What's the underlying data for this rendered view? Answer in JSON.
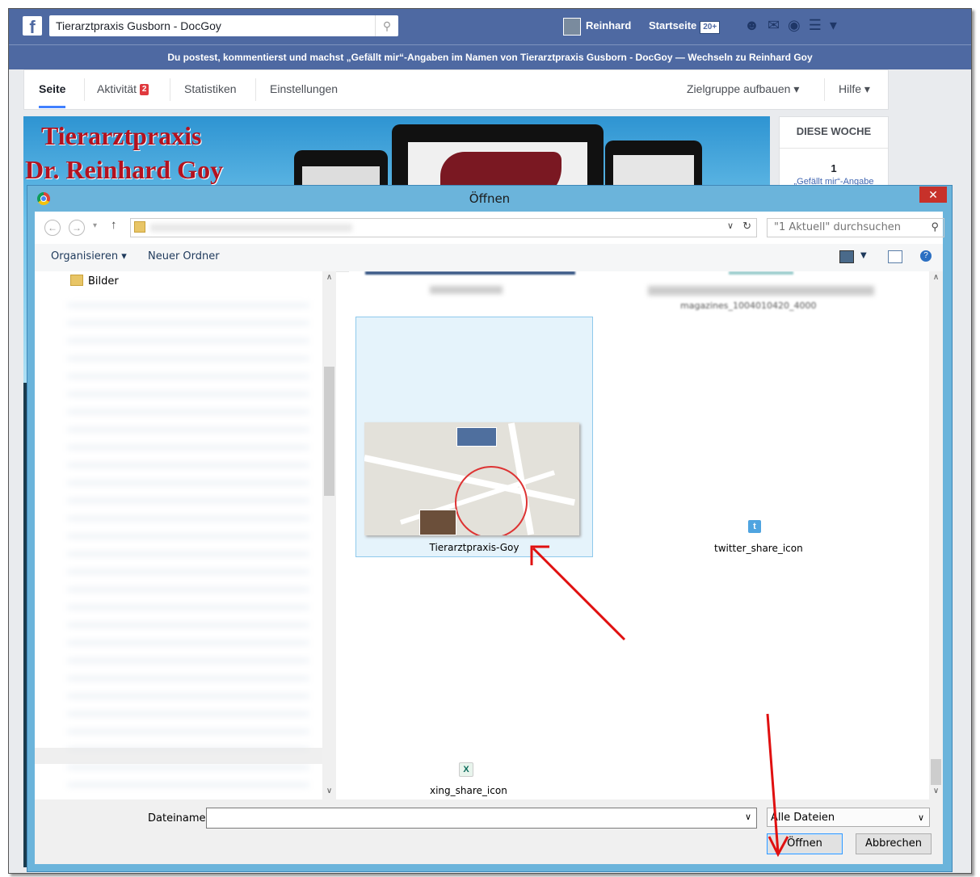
{
  "facebook": {
    "search_value": "Tierarztpraxis Gusborn - DocGoy",
    "user_name": "Reinhard",
    "home_label": "Startseite",
    "home_badge": "20+",
    "notice": "Du postest, kommentierst und machst „Gefällt mir“-Angaben im Namen von Tierarztpraxis Gusborn - DocGoy — Wechseln zu Reinhard Goy",
    "tabs": [
      {
        "label": "Seite"
      },
      {
        "label": "Aktivität",
        "badge": "2"
      },
      {
        "label": "Statistiken"
      },
      {
        "label": "Einstellungen"
      }
    ],
    "right_tabs": [
      "Zielgruppe aufbauen ▾",
      "Hilfe ▾"
    ],
    "cover_title_line1": "Tierarztpraxis",
    "cover_title_line2": "Dr. Reinhard Goy",
    "sidebox_title": "DIESE WOCHE",
    "sidebox_count": "1",
    "sidebox_sub": "„Gefällt mir“-Angabe"
  },
  "dialog": {
    "title": "Öffnen",
    "close": "✕",
    "search_placeholder": "\"1 Aktuell\" durchsuchen",
    "cmd_organize": "Organisieren ▾",
    "cmd_new_folder": "Neuer Ordner",
    "tree_item": "Bilder",
    "files": [
      {
        "name": "Tierarztpraxis-Goy",
        "selected": true
      },
      {
        "name": "twitter_share_icon"
      },
      {
        "name": "xing_share_icon"
      }
    ],
    "partial_caption": "magazines_1004010420_4000",
    "filename_label": "Dateiname:",
    "filename_value": "",
    "filetype": "Alle Dateien",
    "open_button": "Öffnen",
    "cancel_button": "Abbrechen"
  },
  "colors": {
    "facebook_blue": "#4e69a2",
    "dialog_frame": "#6bb4db",
    "close_red": "#c7312a",
    "annotation_red": "#e01010",
    "selection_bg": "#e5f3fb"
  }
}
